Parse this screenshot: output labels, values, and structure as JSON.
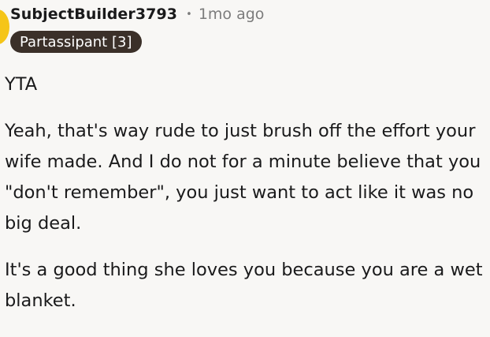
{
  "comment": {
    "username": "SubjectBuilder3793",
    "separator": "•",
    "timestamp": "1mo ago",
    "flair": "Partassipant [3]",
    "paragraphs": [
      "YTA",
      "Yeah, that's way rude to just brush off the effort your wife made. And I do not for a minute believe that you \"don't remember\", you just want to act like it was no big deal.",
      "It's a good thing she loves you because you are a wet blanket."
    ]
  },
  "colors": {
    "background": "#f8f7f5",
    "avatar": "#f5c518",
    "flair_background": "#3b3029",
    "muted_text": "#7c7c7c"
  }
}
